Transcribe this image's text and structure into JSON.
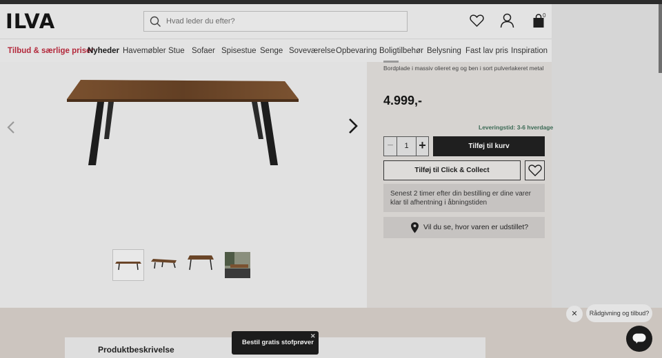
{
  "header": {
    "logo": "ILVA",
    "search_placeholder": "Hvad leder du efter?",
    "cart_count": "0"
  },
  "icons": {
    "search": "search-icon",
    "wishlist": "heart-icon",
    "account": "user-icon",
    "cart": "shopping-bag-icon",
    "location": "map-pin-icon",
    "chat": "chat-icon"
  },
  "nav": {
    "items": [
      {
        "label": "Tilbud & særlige priser"
      },
      {
        "label": "Nyheder"
      },
      {
        "label": "Havemøbler"
      },
      {
        "label": "Stue"
      },
      {
        "label": "Sofaer"
      },
      {
        "label": "Spisestue"
      },
      {
        "label": "Senge"
      },
      {
        "label": "Soveværelse"
      },
      {
        "label": "Opbevaring"
      },
      {
        "label": "Boligtilbehør"
      },
      {
        "label": "Belysning"
      },
      {
        "label": "Fast lav pris"
      },
      {
        "label": "Inspiration"
      }
    ]
  },
  "product": {
    "description_short": "Bordplade i massiv olieret eg og ben i sort pulverlakeret metal",
    "price": "4.999,-",
    "delivery": "Leveringstid: 3-6 hverdage",
    "quantity": "1",
    "qty_minus": "−",
    "qty_plus": "+",
    "add_to_cart": "Tilføj til kurv",
    "click_collect": "Tilføj til Click & Collect",
    "pickup_info": "Senest 2 timer efter din bestilling er dine varer klar til afhentning i åbningstiden",
    "showroom": "Vil du se, hvor varen er udstillet?"
  },
  "lower": {
    "section_title": "Produktbeskrivelse"
  },
  "toast": {
    "label": "Bestil gratis stofprøver",
    "close": "✕"
  },
  "chat": {
    "close": "✕",
    "bubble": "Rådgivning og tilbud?"
  },
  "colors": {
    "sale": "#b3283b",
    "delivery": "#3b6a55",
    "primary_button": "#1f1f1f"
  }
}
